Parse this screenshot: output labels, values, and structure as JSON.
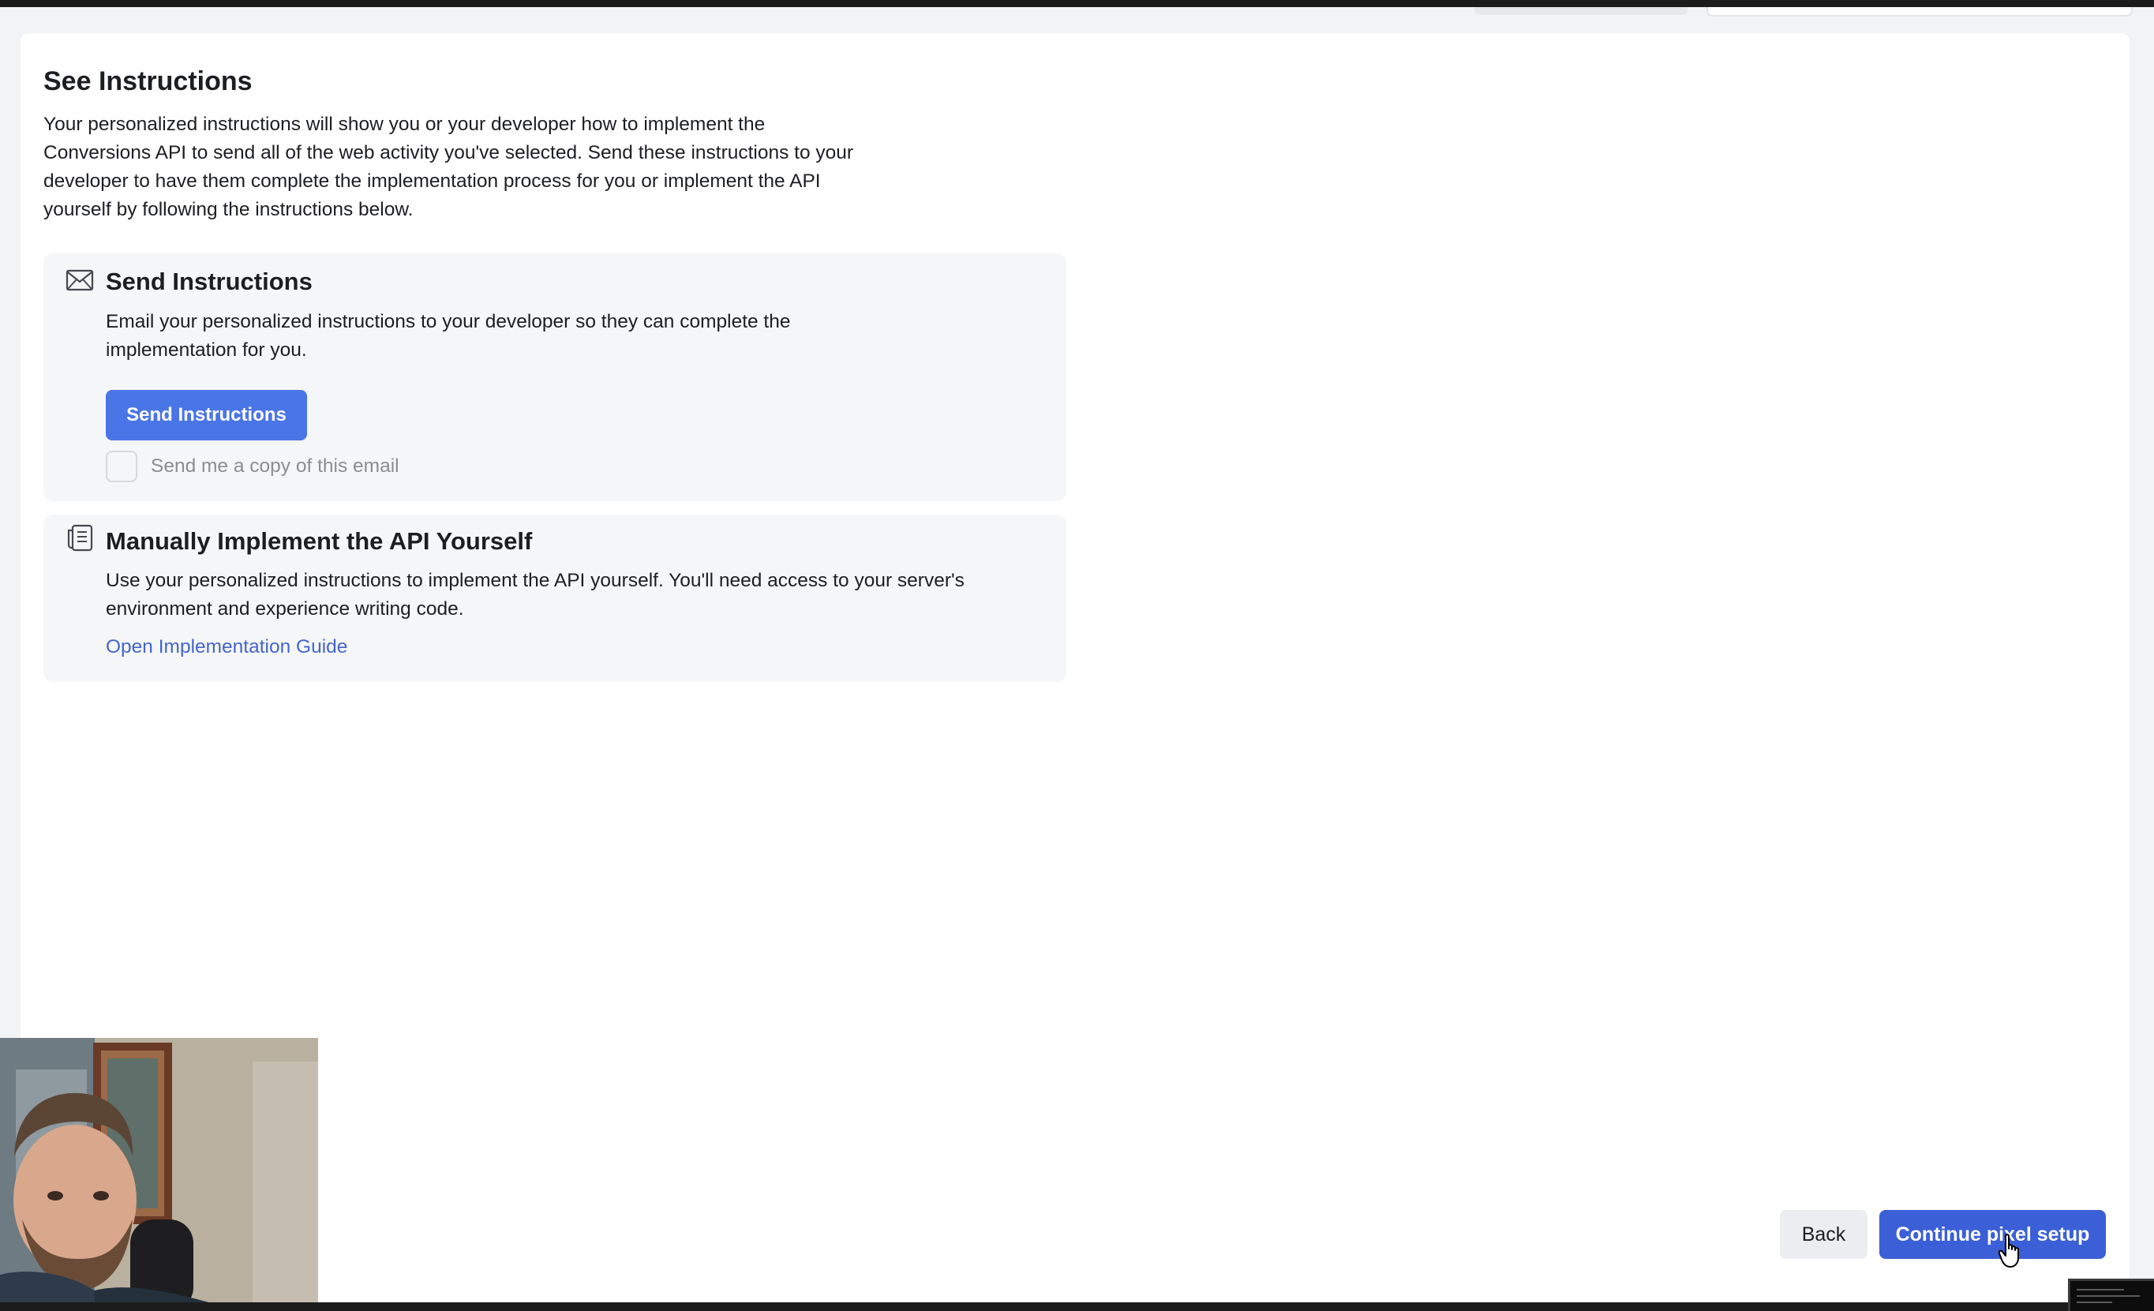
{
  "page": {
    "title": "See Instructions",
    "description": "Your personalized instructions will show you or your developer how to implement the Conversions API to send all of the web activity you've selected. Send these instructions to your developer to have them complete the implementation process for you or implement the API yourself by following the instructions below."
  },
  "send_card": {
    "icon": "envelope-icon",
    "title": "Send Instructions",
    "text": "Email your personalized instructions to your developer so they can complete the implementation for you.",
    "button_label": "Send Instructions",
    "checkbox_label": "Send me a copy of this email",
    "checkbox_checked": false
  },
  "manual_card": {
    "icon": "document-icon",
    "title": "Manually Implement the API Yourself",
    "text": "Use your personalized instructions to implement the API yourself. You'll need access to your server's environment and experience writing code.",
    "link_label": "Open Implementation Guide"
  },
  "footer": {
    "back_label": "Back",
    "continue_label": "Continue pixel setup"
  },
  "colors": {
    "primary_button": "#4a75e6",
    "continue_button": "#3b5fd6",
    "link": "#4565c9",
    "card_background": "#f5f6f7"
  }
}
